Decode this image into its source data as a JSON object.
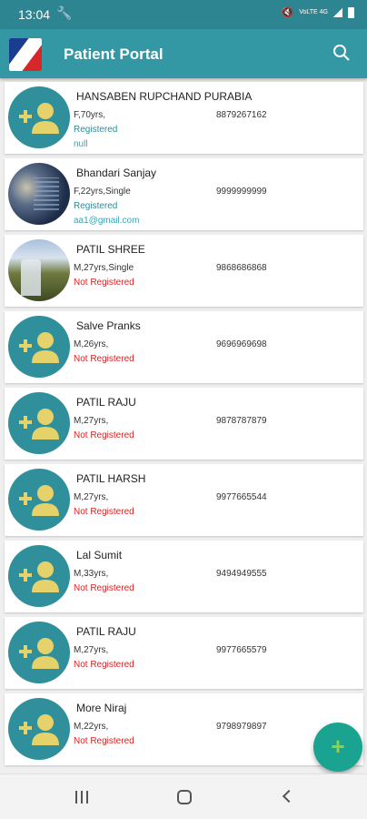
{
  "status_bar": {
    "time": "13:04",
    "network": "VoLTE 4G"
  },
  "app": {
    "title": "Patient Portal"
  },
  "patients": [
    {
      "name": "HANSABEN RUPCHAND PURABIA",
      "details": "F,70yrs,",
      "phone": "8879267162",
      "status": "Registered",
      "email": "null",
      "avatar": "placeholder"
    },
    {
      "name": "Bhandari Sanjay",
      "details": "F,22yrs,Single",
      "phone": "9999999999",
      "status": "Registered",
      "email": "aa1@gmail.com",
      "avatar": "photo1"
    },
    {
      "name": "PATIL SHREE",
      "details": "M,27yrs,Single",
      "phone": "9868686868",
      "status": "Not Registered",
      "email": "",
      "avatar": "photo2"
    },
    {
      "name": "Salve Pranks",
      "details": "M,26yrs,",
      "phone": "9696969698",
      "status": "Not Registered",
      "email": "",
      "avatar": "placeholder"
    },
    {
      "name": "PATIL RAJU",
      "details": "M,27yrs,",
      "phone": "9878787879",
      "status": "Not Registered",
      "email": "",
      "avatar": "placeholder"
    },
    {
      "name": "PATIL HARSH",
      "details": "M,27yrs,",
      "phone": "9977665544",
      "status": "Not Registered",
      "email": "",
      "avatar": "placeholder"
    },
    {
      "name": "Lal Sumit",
      "details": "M,33yrs,",
      "phone": "9494949555",
      "status": "Not Registered",
      "email": "",
      "avatar": "placeholder"
    },
    {
      "name": "PATIL RAJU",
      "details": "M,27yrs,",
      "phone": "9977665579",
      "status": "Not Registered",
      "email": "",
      "avatar": "placeholder"
    },
    {
      "name": "More Niraj",
      "details": "M,22yrs,",
      "phone": "9798979897",
      "status": "Not Registered",
      "email": "",
      "avatar": "placeholder"
    }
  ],
  "fab": {
    "label": "+"
  },
  "colors": {
    "primary": "#3497a4",
    "statusbar": "#2e8592",
    "registered": "#2e8b99",
    "not_registered": "#e02020",
    "fab": "#1aa391"
  }
}
